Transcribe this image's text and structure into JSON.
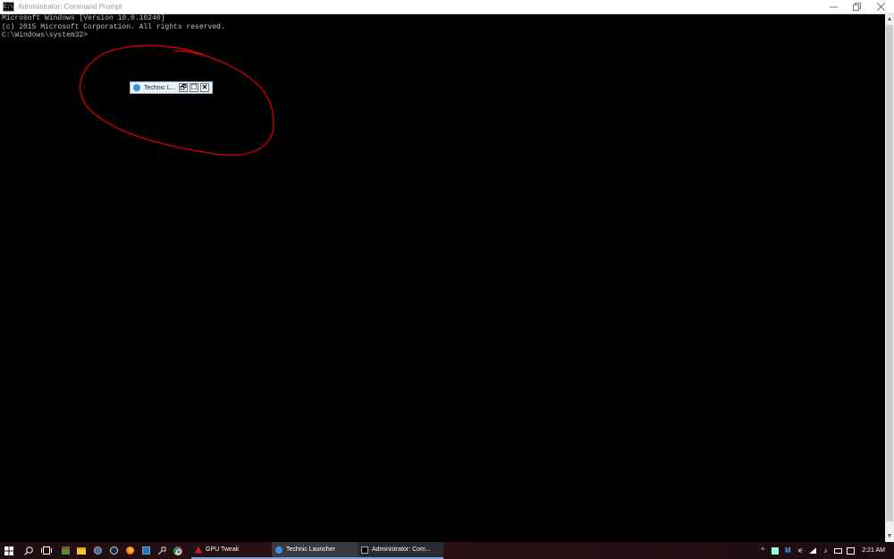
{
  "window": {
    "title": "Administrator: Command Prompt",
    "icon": "cmd-icon",
    "controls": [
      "minimize-icon",
      "restore-icon",
      "close-icon"
    ]
  },
  "console": {
    "lines": [
      "Microsoft Windows [Version 10.0.10240]",
      "(c) 2015 Microsoft Corporation. All rights reserved.",
      "",
      "C:\\Windows\\system32>"
    ]
  },
  "minimized_window": {
    "title": "Technic L...",
    "restore": "🗗",
    "maximize": "☐",
    "close": "✕"
  },
  "taskbar": {
    "pinned": [
      "windows-start-icon",
      "search-icon",
      "task-view-icon",
      "minecraft-icon",
      "file-explorer-icon",
      "app-icon",
      "steam-icon",
      "firefox-icon",
      "app-icon-2",
      "app-icon-3",
      "chrome-icon"
    ],
    "tasks": [
      {
        "label": "GPU Tweak",
        "icon": "gpu-tweak-icon"
      },
      {
        "label": "Technic Launcher",
        "icon": "technic-icon"
      },
      {
        "label": "Administrator: Com...",
        "icon": "cmd-icon"
      }
    ],
    "tray_icons": [
      "chevron-up-icon",
      "tray-app-icon",
      "malwarebytes-icon",
      "network-icon",
      "wifi-icon",
      "volume-icon",
      "keyboard-icon",
      "notification-icon"
    ],
    "clock": "2:21 AM"
  },
  "colors": {
    "console_bg": "#000000",
    "console_text": "#c0c0c0",
    "annotation": "#e00000",
    "taskbar": "#241014"
  }
}
